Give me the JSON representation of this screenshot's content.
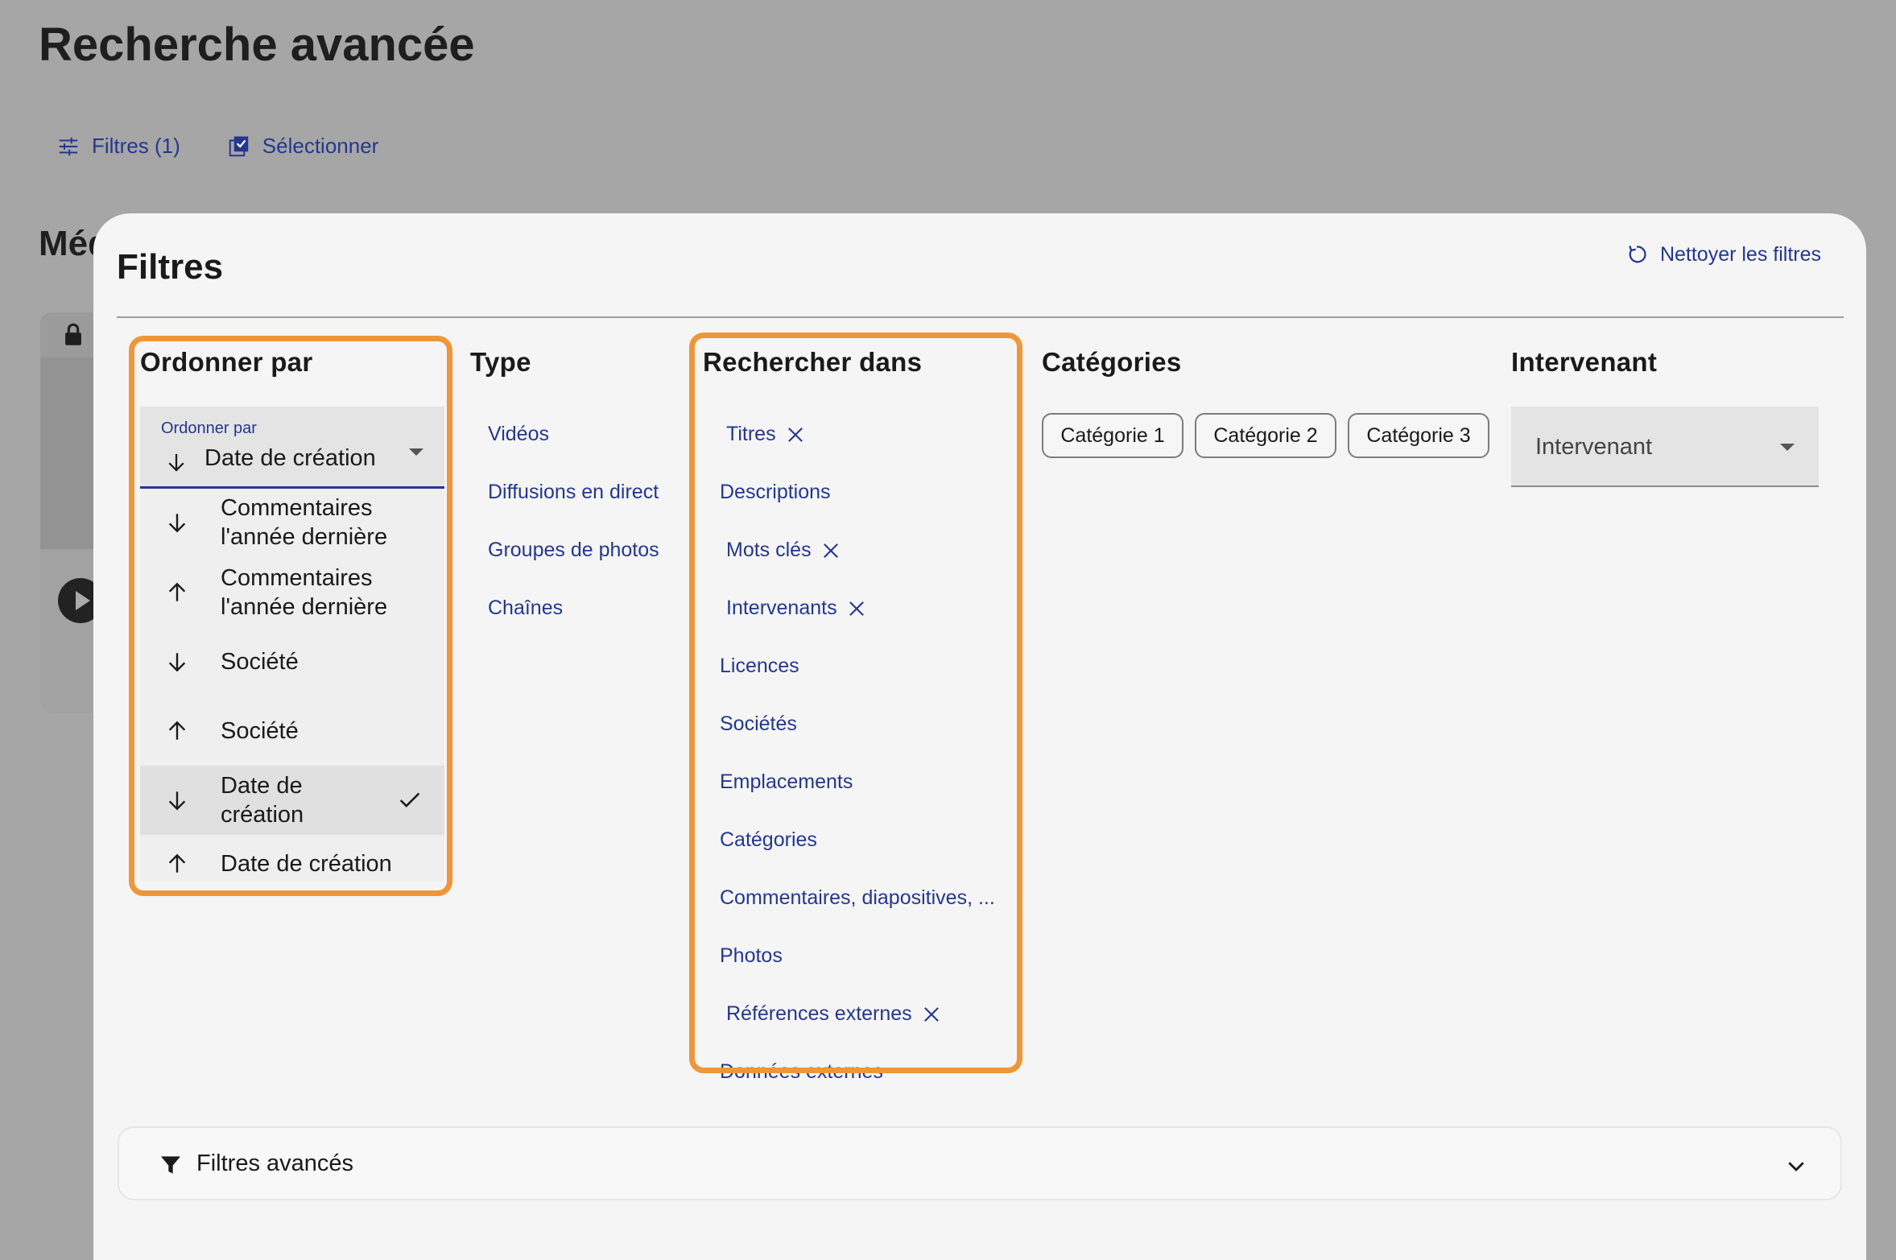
{
  "page": {
    "title": "Recherche avancée",
    "section_heading": "Méd"
  },
  "toolbar": {
    "filters_label": "Filtres (1)",
    "select_label": "Sélectionner"
  },
  "filters_panel": {
    "title": "Filtres",
    "clear_label": "Nettoyer les filtres",
    "order_by": {
      "heading": "Ordonner par",
      "field_label": "Ordonner par",
      "selected_value": "Date de création",
      "options": [
        {
          "label": "Commentaires l'année dernière",
          "direction": "down",
          "selected": false
        },
        {
          "label": "Commentaires l'année dernière",
          "direction": "up",
          "selected": false
        },
        {
          "label": "Société",
          "direction": "down",
          "selected": false
        },
        {
          "label": "Société",
          "direction": "up",
          "selected": false
        },
        {
          "label": "Date de création",
          "direction": "down",
          "selected": true
        },
        {
          "label": "Date de création",
          "direction": "up",
          "selected": false
        }
      ]
    },
    "type": {
      "heading": "Type",
      "items": [
        "Vidéos",
        "Diffusions en direct",
        "Groupes de photos",
        "Chaînes"
      ]
    },
    "search_in": {
      "heading": "Rechercher dans",
      "items": [
        {
          "label": "Titres",
          "active": true
        },
        {
          "label": "Descriptions",
          "active": false
        },
        {
          "label": "Mots clés",
          "active": true
        },
        {
          "label": "Intervenants",
          "active": true
        },
        {
          "label": "Licences",
          "active": false
        },
        {
          "label": "Sociétés",
          "active": false
        },
        {
          "label": "Emplacements",
          "active": false
        },
        {
          "label": "Catégories",
          "active": false
        },
        {
          "label": "Commentaires, diapositives, ...",
          "active": false
        },
        {
          "label": "Photos",
          "active": false
        },
        {
          "label": "Références externes",
          "active": true
        },
        {
          "label": "Données externes",
          "active": false
        }
      ]
    },
    "categories": {
      "heading": "Catégories",
      "chips": [
        "Catégorie 1",
        "Catégorie 2",
        "Catégorie 3"
      ]
    },
    "speaker": {
      "heading": "Intervenant",
      "placeholder": "Intervenant"
    },
    "advanced": {
      "label": "Filtres avancés"
    }
  },
  "colors": {
    "accent": "#24378e",
    "highlight": "#f0963a",
    "overlay": "#a6a6a6",
    "panel_bg": "#f5f5f5"
  },
  "icons": [
    "sliders-icon",
    "select-checkbox-icon",
    "refresh-icon",
    "arrow-down-icon",
    "arrow-up-icon",
    "check-icon",
    "close-icon",
    "caret-down-icon",
    "filter-funnel-icon",
    "chevron-down-icon",
    "lock-icon",
    "play-icon"
  ]
}
